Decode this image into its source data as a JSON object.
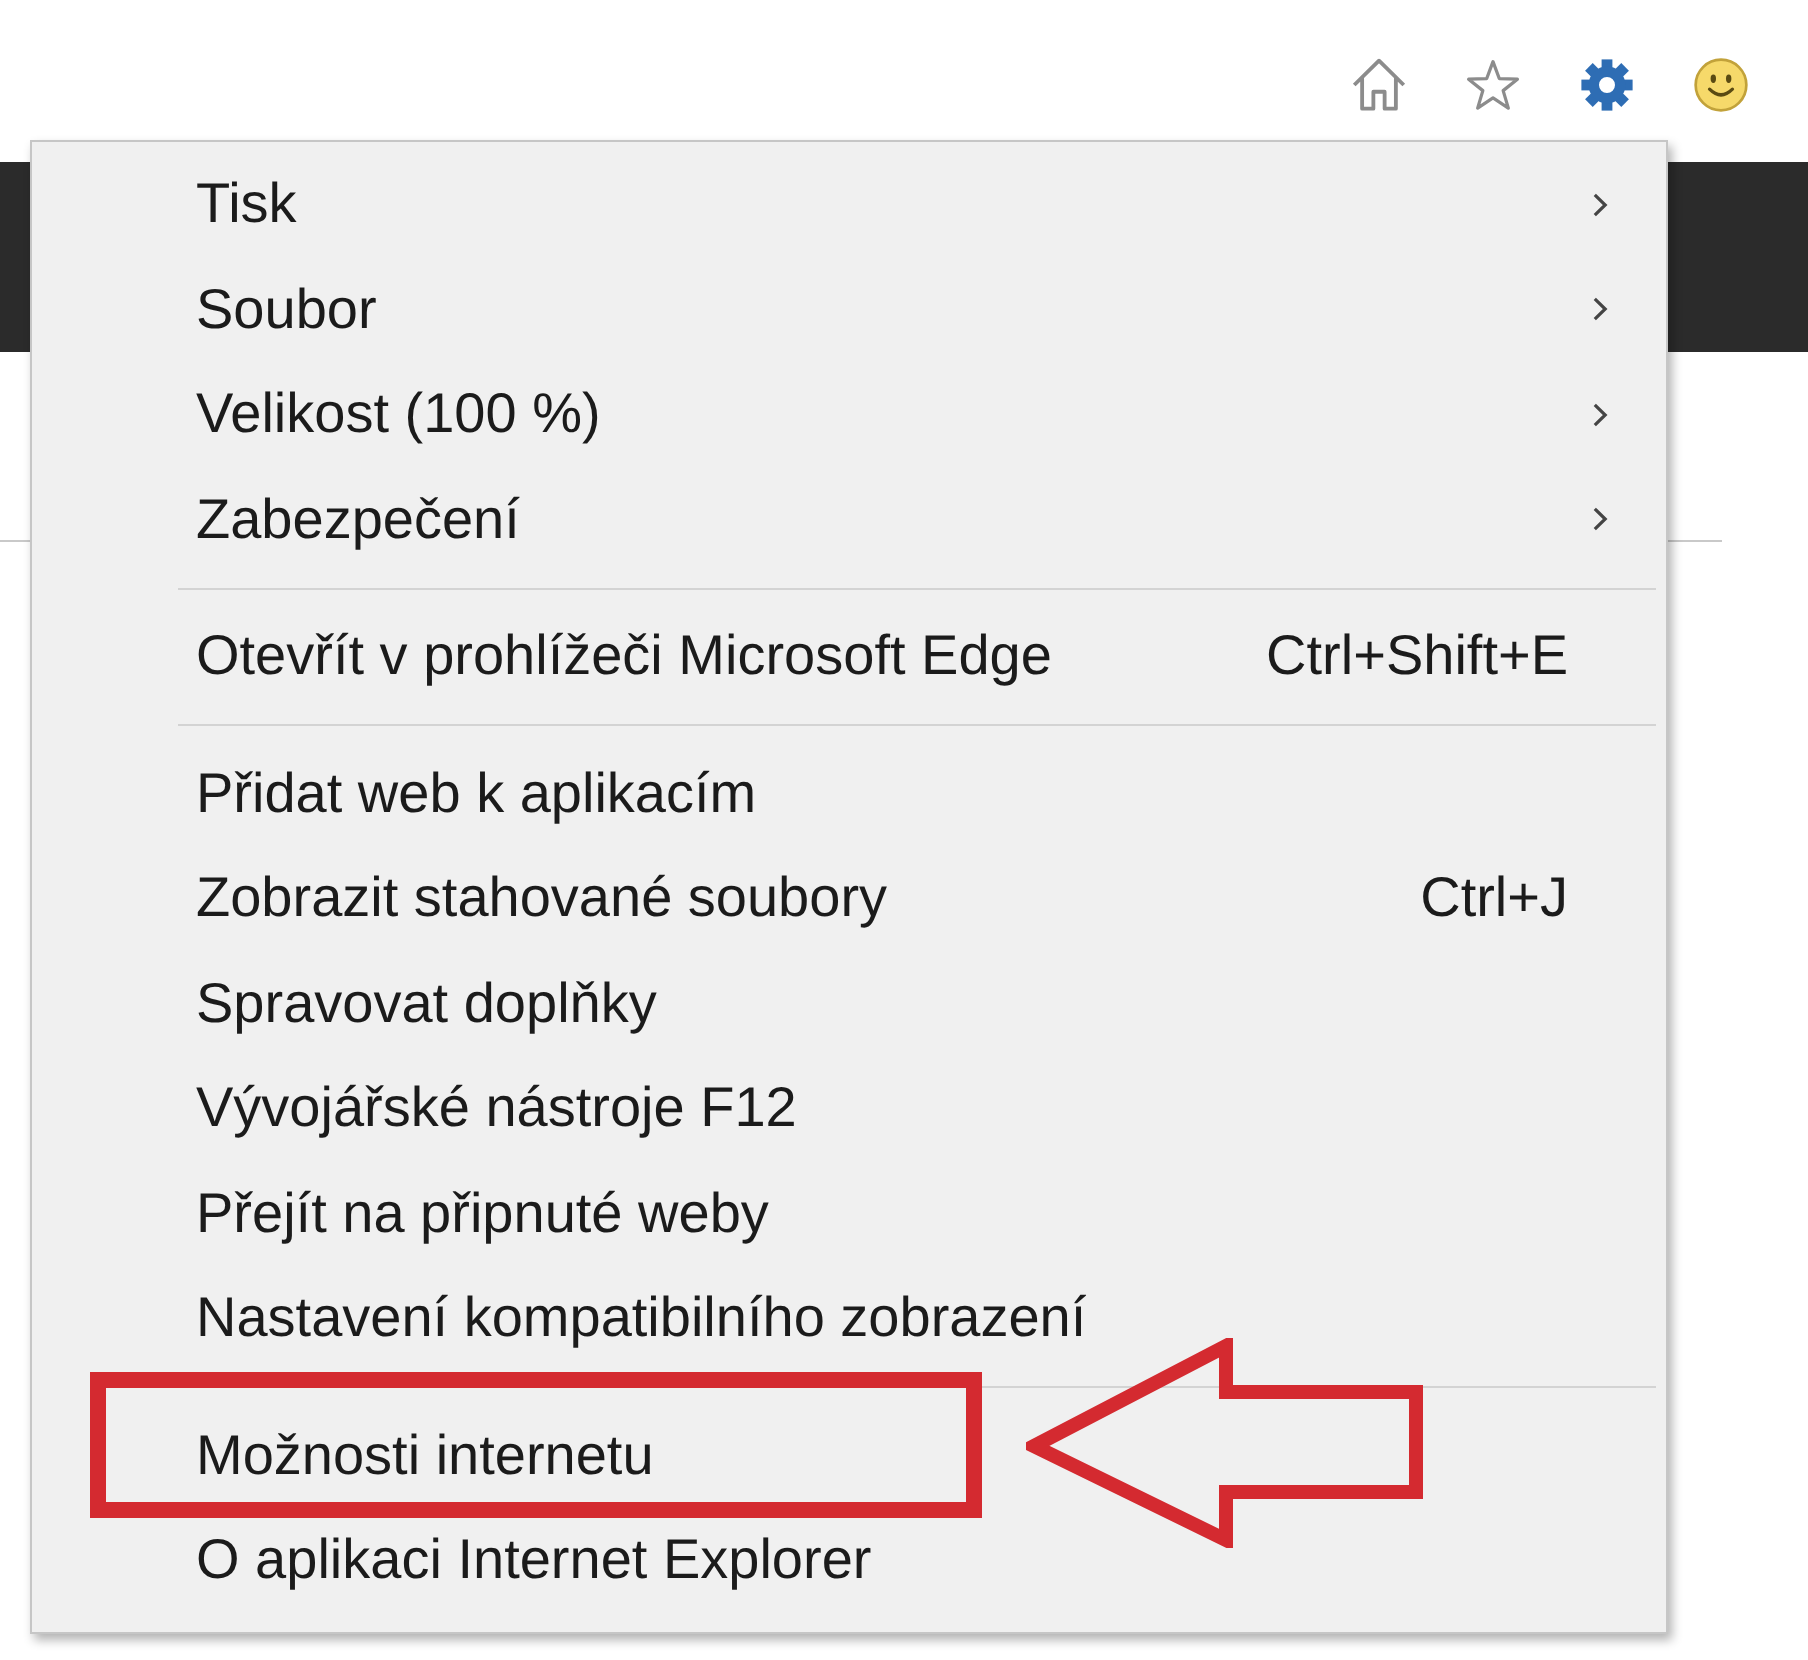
{
  "toolbar": [
    {
      "kind": "home",
      "selected": false
    },
    {
      "kind": "favorites",
      "selected": false
    },
    {
      "kind": "tools",
      "selected": true
    },
    {
      "kind": "smiley",
      "selected": false
    }
  ],
  "menu": {
    "sections": [
      {
        "items": [
          {
            "label": "Tisk",
            "submenu": true,
            "highlighted": false
          },
          {
            "label": "Soubor",
            "submenu": true,
            "highlighted": false
          },
          {
            "label": "Velikost (100 %)",
            "submenu": true,
            "highlighted": false
          },
          {
            "label": "Zabezpečení",
            "submenu": true,
            "highlighted": false
          }
        ]
      },
      {
        "items": [
          {
            "label": "Otevřít v prohlížeči Microsoft Edge",
            "shortcut": "Ctrl+Shift+E",
            "submenu": false,
            "highlighted": false
          }
        ]
      },
      {
        "items": [
          {
            "label": "Přidat web k aplikacím",
            "submenu": false,
            "highlighted": false
          },
          {
            "label": "Zobrazit stahované soubory",
            "shortcut": "Ctrl+J",
            "submenu": false,
            "highlighted": false
          },
          {
            "label": "Spravovat doplňky",
            "submenu": false,
            "highlighted": false
          },
          {
            "label": "Vývojářské nástroje F12",
            "submenu": false,
            "highlighted": false
          },
          {
            "label": "Přejít na připnuté weby",
            "submenu": false,
            "highlighted": false
          },
          {
            "label": "Nastavení kompatibilního zobrazení",
            "submenu": false,
            "highlighted": false
          }
        ]
      },
      {
        "items": [
          {
            "label": "Možnosti internetu",
            "submenu": false,
            "highlighted": true
          },
          {
            "label": "O aplikaci Internet Explorer",
            "submenu": false,
            "highlighted": false
          }
        ]
      }
    ]
  }
}
